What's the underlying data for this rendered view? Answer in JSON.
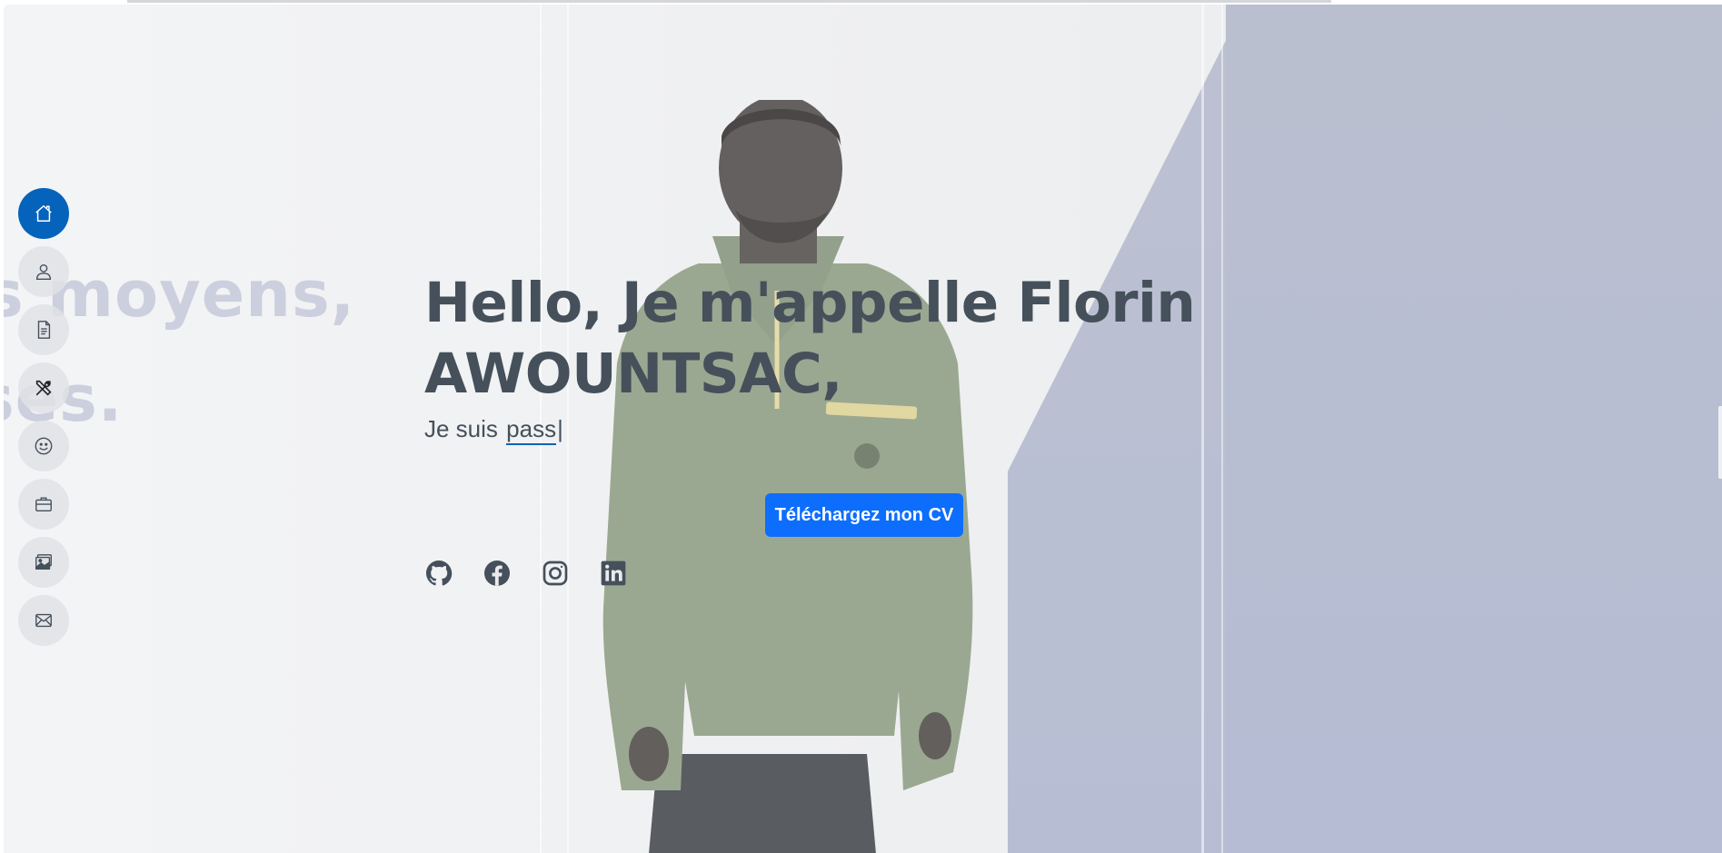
{
  "background_words": [
    "s moyens,",
    "ses."
  ],
  "hero": {
    "title": "Hello, Je m'appelle Florin AWOUNTSAC,",
    "subtitle_prefix": "Je suis",
    "typed_text": "pass",
    "cursor": "|",
    "cv_button": "Téléchargez mon CV"
  },
  "sidenav": {
    "items": [
      {
        "icon": "house-icon",
        "active": true
      },
      {
        "icon": "person-icon",
        "active": false
      },
      {
        "icon": "file-text-icon",
        "active": false
      },
      {
        "icon": "tools-icon",
        "active": false
      },
      {
        "icon": "smile-icon",
        "active": false
      },
      {
        "icon": "briefcase-icon",
        "active": false
      },
      {
        "icon": "images-icon",
        "active": false
      },
      {
        "icon": "envelope-icon",
        "active": false
      }
    ]
  },
  "socials": [
    "github-icon",
    "facebook-icon",
    "instagram-icon",
    "linkedin-icon"
  ],
  "colors": {
    "accent": "#0563bb",
    "button": "#0d6efd",
    "heading": "#45505b",
    "nav_bg": "#e1e2e6"
  }
}
